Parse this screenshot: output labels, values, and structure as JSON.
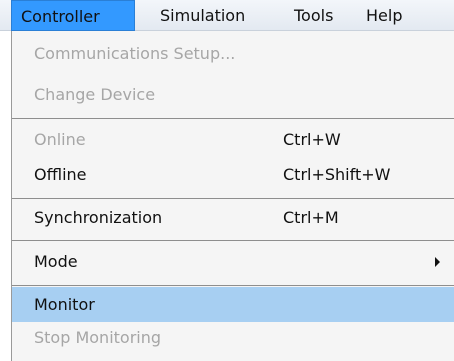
{
  "menubar": {
    "items": [
      {
        "label": "Controller"
      },
      {
        "label": "Simulation"
      },
      {
        "label": "Tools"
      },
      {
        "label": "Help"
      }
    ]
  },
  "dropdown": {
    "items": [
      {
        "label": "Communications Setup...",
        "enabled": false
      },
      {
        "label": "Change Device",
        "enabled": false
      },
      {
        "label": "Online",
        "shortcut": "Ctrl+W",
        "enabled": false
      },
      {
        "label": "Offline",
        "shortcut": "Ctrl+Shift+W",
        "enabled": true
      },
      {
        "label": "Synchronization",
        "shortcut": "Ctrl+M",
        "enabled": true
      },
      {
        "label": "Mode",
        "has_submenu": true,
        "enabled": true
      },
      {
        "label": "Monitor",
        "enabled": true,
        "highlighted": true
      },
      {
        "label": "Stop Monitoring",
        "enabled": false
      }
    ]
  },
  "colors": {
    "menubar_active": "#3399ff",
    "item_highlight": "#a7cff2",
    "disabled_text": "#a6a6a6"
  }
}
